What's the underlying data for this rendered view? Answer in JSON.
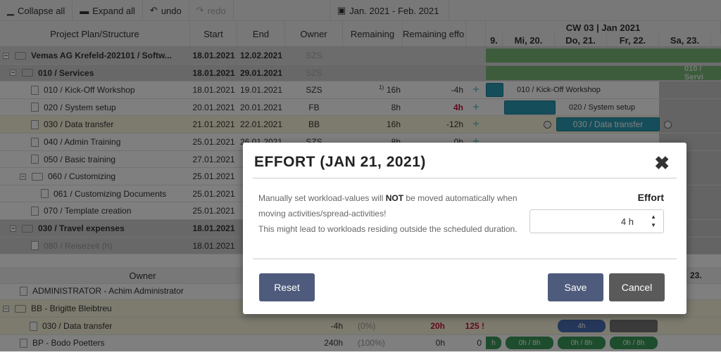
{
  "toolbar": {
    "collapse": "Collapse all",
    "expand": "Expand all",
    "undo": "undo",
    "redo": "redo",
    "date_range": "Jan. 2021 - Feb. 2021"
  },
  "columns": {
    "plan": "Project Plan/Structure",
    "start": "Start",
    "end": "End",
    "owner": "Owner",
    "remaining": "Remaining",
    "remaining_effort": "Remaining effo"
  },
  "gantt": {
    "week": "CW 03 | Jan 2021",
    "days": [
      "9.",
      "Mi, 20.",
      "Do, 21.",
      "Fr, 22.",
      "Sa, 23."
    ]
  },
  "rows": [
    {
      "name": "Vemas AG Krefeld-202101 / Softw...",
      "start": "18.01.2021",
      "end": "12.02.2021",
      "owner": "SZS",
      "remaining": "",
      "effort": ""
    },
    {
      "name": "010 / Services",
      "start": "18.01.2021",
      "end": "29.01.2021",
      "owner": "SZS",
      "remaining": "",
      "effort": ""
    },
    {
      "name": "010 / Kick-Off Workshop",
      "start": "18.01.2021",
      "end": "19.01.2021",
      "owner": "SZS",
      "remaining": "16h",
      "note": "1)",
      "effort": "-4h"
    },
    {
      "name": "020 / System setup",
      "start": "20.01.2021",
      "end": "20.01.2021",
      "owner": "FB",
      "remaining": "8h",
      "effort": "4h"
    },
    {
      "name": "030 / Data transfer",
      "start": "21.01.2021",
      "end": "22.01.2021",
      "owner": "BB",
      "remaining": "16h",
      "effort": "-12h"
    },
    {
      "name": "040 / Admin Training",
      "start": "25.01.2021",
      "end": "26.01.2021",
      "owner": "SZS",
      "remaining": "8h",
      "effort": "0h"
    },
    {
      "name": "050 / Basic training",
      "start": "27.01.2021"
    },
    {
      "name": "060 / Customizing",
      "start": "25.01.2021"
    },
    {
      "name": "061 / Customizing Documents",
      "start": "25.01.2021"
    },
    {
      "name": "070 / Template creation",
      "start": "25.01.2021"
    },
    {
      "name": "030 / Travel expenses",
      "start": "18.01.2021"
    },
    {
      "name": "080 / Reisezeit (h)",
      "start": "18.01.2021"
    }
  ],
  "bars": {
    "services": "010 / Servi",
    "kickoff": "010 / Kick-Off Workshop",
    "setup": "020 / System setup",
    "transfer": "030 / Data transfer"
  },
  "owner_section": {
    "header": "Owner",
    "day_partial": "23.",
    "rows": [
      {
        "name": "ADMINISTRATOR - Achim Administrator"
      },
      {
        "name": "BB - Brigitte Bleibtreu"
      },
      {
        "name": "030 / Data transfer",
        "v1": "-4h",
        "v2": "(0%)",
        "v3": "20h",
        "v4": "125 !",
        "cell": "4h"
      },
      {
        "name": "BP - Bodo Poetters",
        "v1": "240h",
        "v2": "(100%)",
        "v3": "0h",
        "v4": "0",
        "cells": [
          "h",
          "0h / 8h",
          "0h / 8h",
          "0h / 8h"
        ]
      }
    ]
  },
  "modal": {
    "title": "EFFORT (JAN 21, 2021)",
    "msg_pre": "Manually set workload-values will ",
    "msg_bold": "NOT",
    "msg_post": " be moved automatically when moving activities/spread-activities!",
    "msg2": "This might lead to workloads residing outside the scheduled duration.",
    "effort_label": "Effort",
    "effort_value": "4 h",
    "reset": "Reset",
    "save": "Save",
    "cancel": "Cancel"
  },
  "colors": {
    "accent": "#4f5b7c",
    "cancel": "#5a5a5a",
    "teal": "#2a9db5",
    "green": "#3a9a5a",
    "red": "#c0143c"
  }
}
